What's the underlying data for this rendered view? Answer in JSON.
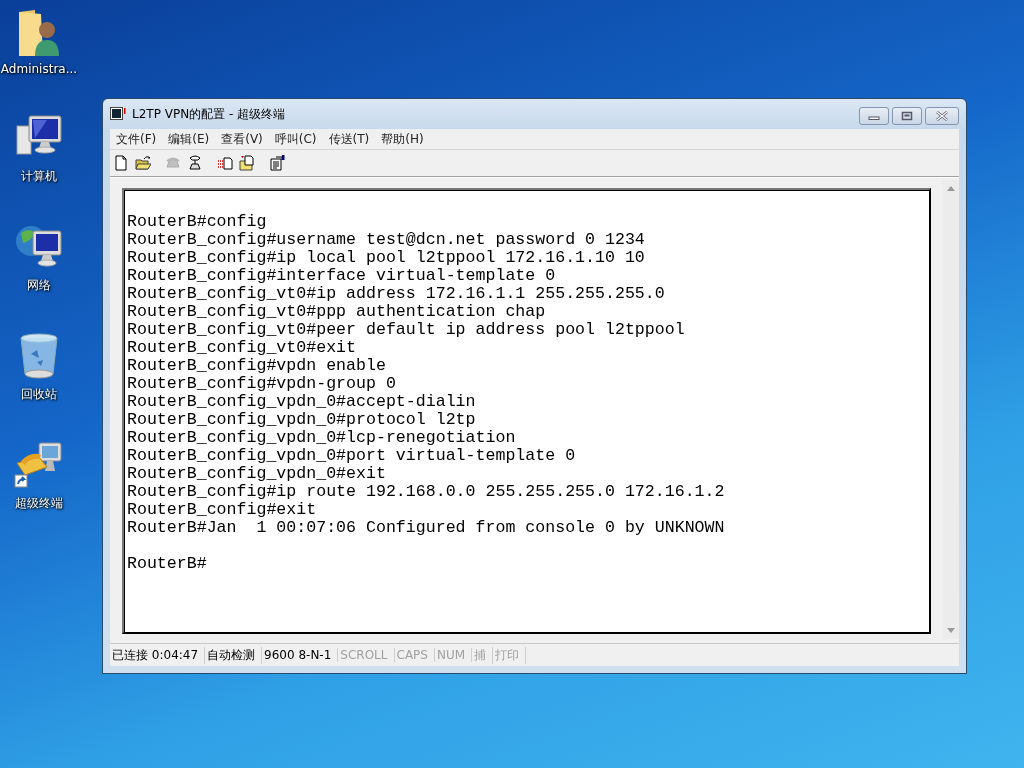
{
  "desktop_icons": [
    {
      "kind": "user-folder",
      "label": "Administra..."
    },
    {
      "kind": "computer",
      "label": "计算机"
    },
    {
      "kind": "network",
      "label": "网络"
    },
    {
      "kind": "recycle-bin",
      "label": "回收站"
    },
    {
      "kind": "terminal-shortcut",
      "label": "超级终端"
    }
  ],
  "window": {
    "title": "L2TP VPN的配置 - 超级终端",
    "menu": [
      "文件(F)",
      "编辑(E)",
      "查看(V)",
      "呼叫(C)",
      "传送(T)",
      "帮助(H)"
    ],
    "toolbar": [
      {
        "kind": "new",
        "disabled": false
      },
      {
        "kind": "open",
        "disabled": false
      },
      {
        "kind": "call",
        "disabled": true
      },
      {
        "kind": "hangup",
        "disabled": false
      },
      {
        "kind": "send",
        "disabled": false
      },
      {
        "kind": "receive",
        "disabled": false
      },
      {
        "kind": "properties",
        "disabled": false
      }
    ],
    "terminal_blocks": [
      [
        "RouterB#config",
        "RouterB_config#username test@dcn.net password 0 1234",
        "RouterB_config#ip local pool l2tppool 172.16.1.10 10",
        "RouterB_config#interface virtual-template 0",
        "RouterB_config_vt0#ip address 172.16.1.1 255.255.255.0",
        "RouterB_config_vt0#ppp authentication chap",
        "RouterB_config_vt0#peer default ip address pool l2tppool",
        "RouterB_config_vt0#exit",
        "RouterB_config#vpdn enable",
        "RouterB_config#vpdn-group 0",
        "RouterB_config_vpdn_0#accept-dialin",
        "RouterB_config_vpdn_0#protocol l2tp",
        "RouterB_config_vpdn_0#lcp-renegotiation",
        "RouterB_config_vpdn_0#port virtual-template 0",
        "RouterB_config_vpdn_0#exit",
        "RouterB_config#ip route 192.168.0.0 255.255.255.0 172.16.1.2",
        "RouterB_config#exit",
        "RouterB#Jan  1 00:07:06 Configured from console 0 by UNKNOWN"
      ],
      [
        "RouterB#"
      ]
    ],
    "status_bar": [
      {
        "text": "已连接 0:04:47",
        "disabled": false
      },
      {
        "text": "自动检测",
        "disabled": false
      },
      {
        "text": "9600 8-N-1",
        "disabled": false
      },
      {
        "text": "SCROLL",
        "disabled": true
      },
      {
        "text": "CAPS",
        "disabled": true
      },
      {
        "text": "NUM",
        "disabled": true
      },
      {
        "text": "捕",
        "disabled": true
      },
      {
        "text": "打印",
        "disabled": true
      }
    ]
  }
}
